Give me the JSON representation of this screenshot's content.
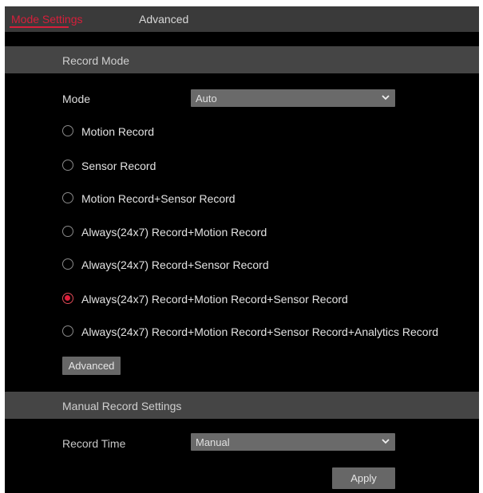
{
  "tabs": {
    "mode_settings": "Mode Settings",
    "advanced": "Advanced"
  },
  "record_mode": {
    "title": "Record Mode",
    "mode_label": "Mode",
    "mode_value": "Auto",
    "options": [
      "Motion Record",
      "Sensor Record",
      "Motion Record+Sensor Record",
      "Always(24x7) Record+Motion Record",
      "Always(24x7) Record+Sensor Record",
      "Always(24x7) Record+Motion Record+Sensor Record",
      "Always(24x7) Record+Motion Record+Sensor Record+Analytics Record"
    ],
    "selected_index": 5,
    "advanced_button": "Advanced"
  },
  "manual": {
    "title": "Manual Record Settings",
    "record_time_label": "Record Time",
    "record_time_value": "Manual"
  },
  "apply_button": "Apply",
  "colors": {
    "accent": "#d61f3a",
    "background": "#000000",
    "header": "#454545",
    "control": "#676767"
  }
}
